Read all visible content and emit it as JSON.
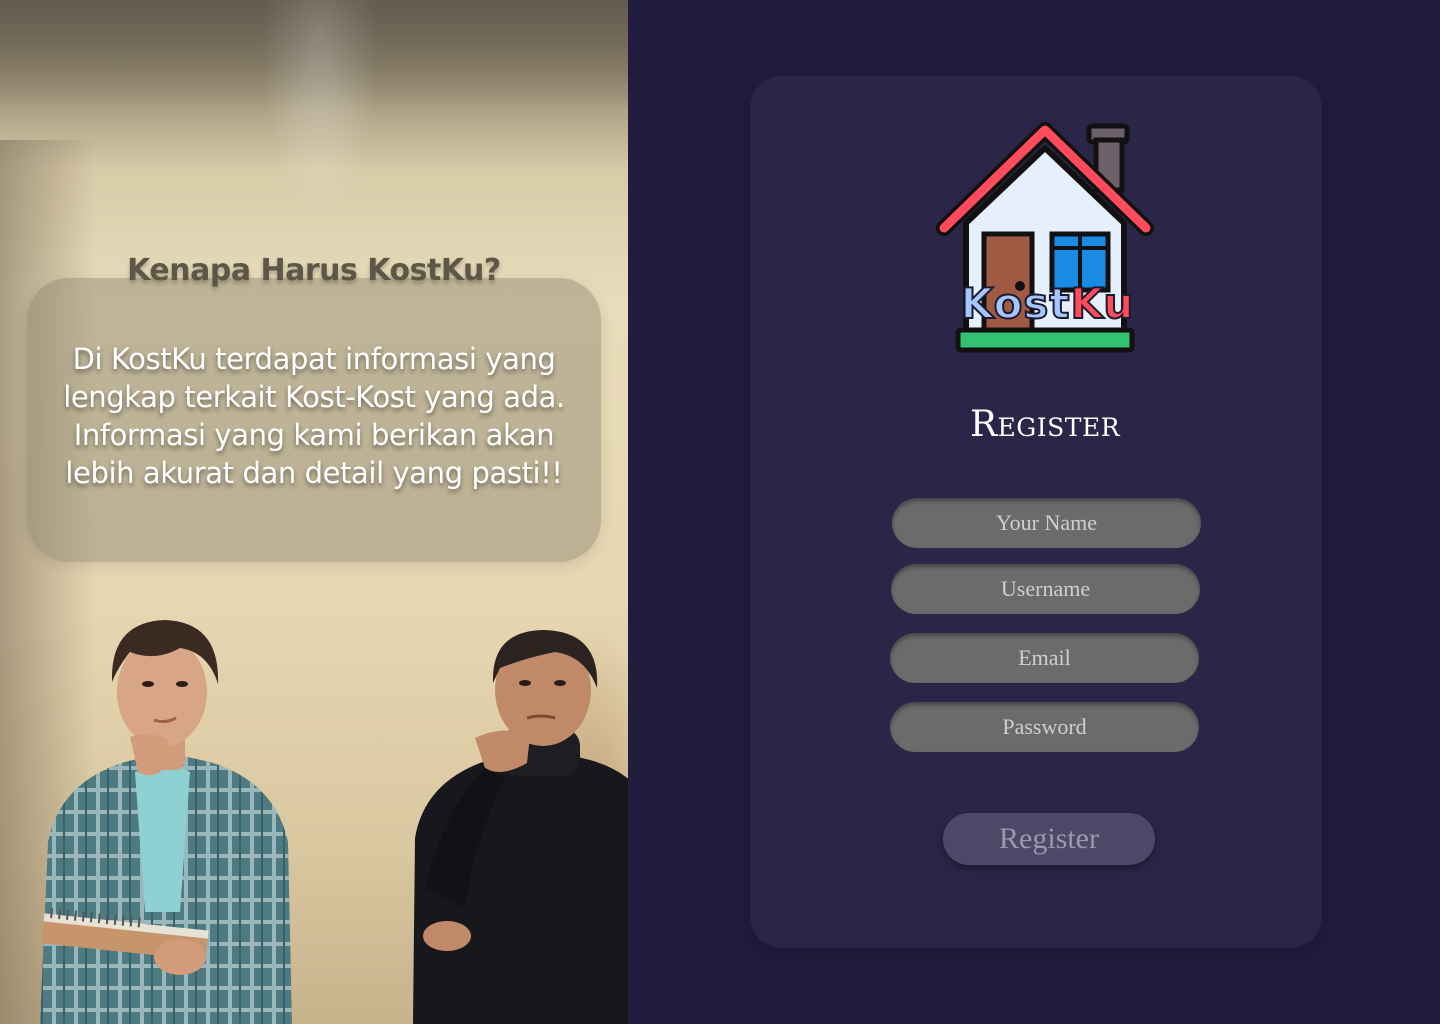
{
  "info": {
    "heading": "Kenapa Harus KostKu?",
    "body": "Di KostKu terdapat informasi yang lengkap terkait Kost-Kost yang ada. Informasi yang kami berikan akan lebih akurat dan detail yang pasti!!"
  },
  "brand": {
    "logo_part1": "Kost",
    "logo_part2": "Ku"
  },
  "form": {
    "title": "Register",
    "name_placeholder": "Your Name",
    "username_placeholder": "Username",
    "email_placeholder": "Email",
    "password_placeholder": "Password",
    "submit_label": "Register"
  },
  "colors": {
    "page_background": "#221d3f",
    "card_background": "#2b2647",
    "field_background": "#6b6b6b",
    "button_background": "#4c4868",
    "logo_blue": "#a6c6ff",
    "logo_red": "#ff4b5c"
  }
}
